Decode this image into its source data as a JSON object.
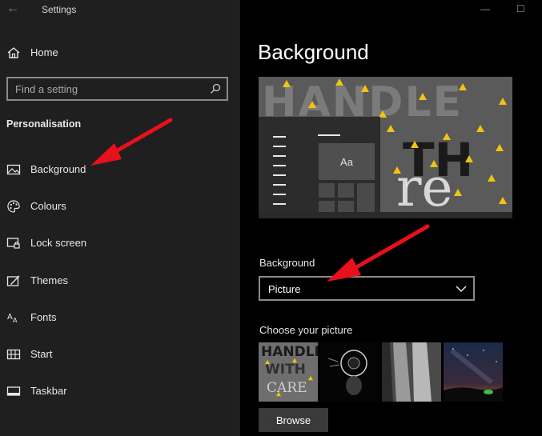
{
  "window": {
    "title": "Settings"
  },
  "sidebar": {
    "home_label": "Home",
    "search": {
      "placeholder": "Find a setting"
    },
    "section_title": "Personalisation",
    "items": [
      {
        "label": "Background",
        "icon": "picture-icon"
      },
      {
        "label": "Colours",
        "icon": "palette-icon"
      },
      {
        "label": "Lock screen",
        "icon": "lock-screen-icon"
      },
      {
        "label": "Themes",
        "icon": "themes-icon"
      },
      {
        "label": "Fonts",
        "icon": "fonts-icon"
      },
      {
        "label": "Start",
        "icon": "start-icon"
      },
      {
        "label": "Taskbar",
        "icon": "taskbar-icon"
      }
    ]
  },
  "main": {
    "title": "Background",
    "preview": {
      "tile_text": "Aa",
      "image_text_line1": "HANDLE",
      "image_text_line2": "TH",
      "image_text_line3": "re"
    },
    "background_label": "Background",
    "background_value": "Picture",
    "choose_label": "Choose your picture",
    "thumbnail_texts": [
      "HANDLE",
      "WITH",
      "CARE"
    ],
    "browse_label": "Browse"
  },
  "colors": {
    "sidebar_bg": "#1f1f1f",
    "main_bg": "#000000",
    "annotation_arrow": "#e8101a"
  }
}
